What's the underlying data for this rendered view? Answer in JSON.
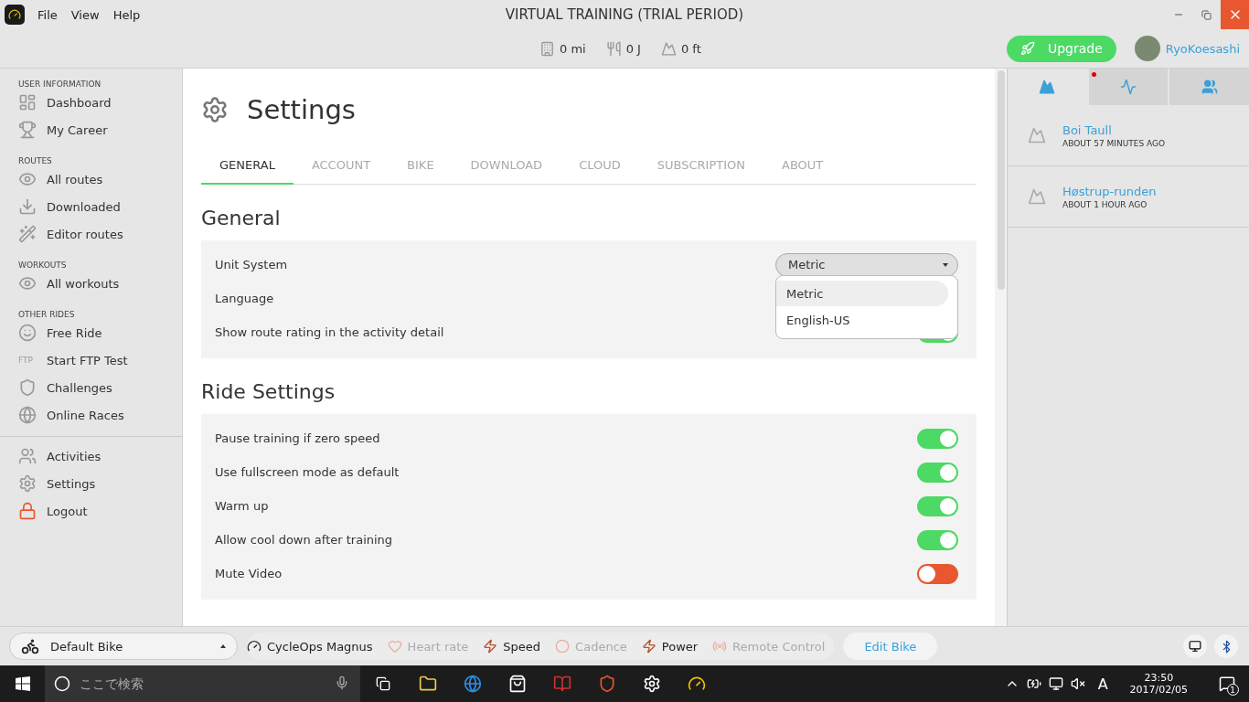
{
  "window": {
    "title": "VIRTUAL TRAINING (TRIAL PERIOD)",
    "menu": [
      "File",
      "View",
      "Help"
    ]
  },
  "stats": [
    "0 mi",
    "0 J",
    "0 ft"
  ],
  "upgrade": "Upgrade",
  "user": "RyoKoesashi",
  "sidebar": [
    {
      "heading": "USER INFORMATION",
      "items": [
        "Dashboard",
        "My Career"
      ]
    },
    {
      "heading": "ROUTES",
      "items": [
        "All routes",
        "Downloaded",
        "Editor routes"
      ]
    },
    {
      "heading": "WORKOUTS",
      "items": [
        "All workouts"
      ]
    },
    {
      "heading": "OTHER RIDES",
      "items": [
        "Free Ride",
        "Start FTP Test",
        "Challenges",
        "Online Races"
      ],
      "ftp_label": "FTP"
    },
    {
      "items": [
        "Activities",
        "Settings",
        "Logout"
      ]
    }
  ],
  "page": {
    "title": "Settings",
    "tabs": [
      {
        "label": "GENERAL",
        "selected": true
      },
      {
        "label": "ACCOUNT",
        "selected": false
      },
      {
        "label": "BIKE",
        "selected": false
      },
      {
        "label": "DOWNLOAD",
        "selected": false
      },
      {
        "label": "CLOUD",
        "selected": false
      },
      {
        "label": "SUBSCRIPTION",
        "selected": false
      },
      {
        "label": "ABOUT",
        "selected": false
      }
    ],
    "sections": [
      {
        "title": "General",
        "rows": [
          {
            "kind": "select",
            "label": "Unit System",
            "value": "Metric",
            "expanded": true,
            "options": [
              {
                "label": "Metric",
                "selected": true
              },
              {
                "label": "English-US",
                "selected": false
              }
            ]
          },
          {
            "kind": "select",
            "label": "Language"
          },
          {
            "kind": "toggle",
            "label": "Show route rating in the activity detail",
            "on": true
          }
        ]
      },
      {
        "title": "Ride Settings",
        "rows": [
          {
            "kind": "toggle",
            "label": "Pause training if zero speed",
            "on": true
          },
          {
            "kind": "toggle",
            "label": "Use fullscreen mode as default",
            "on": true
          },
          {
            "kind": "toggle",
            "label": "Warm up",
            "on": true
          },
          {
            "kind": "toggle",
            "label": "Allow cool down after training",
            "on": true
          },
          {
            "kind": "toggle",
            "label": "Mute Video",
            "on": false
          }
        ]
      }
    ]
  },
  "right_panel": {
    "tabs": [
      {
        "selected": true,
        "notification": false
      },
      {
        "selected": false,
        "notification": true
      },
      {
        "selected": false,
        "notification": false
      }
    ],
    "activities": [
      {
        "name": "Boi Taull",
        "time": "ABOUT 57 MINUTES AGO"
      },
      {
        "name": "Høstrup-runden",
        "time": "ABOUT 1 HOUR AGO"
      }
    ]
  },
  "bottom_bar": {
    "bike": "Default Bike",
    "trainer": "CycleOps Magnus",
    "sensors": [
      {
        "label": "Heart rate",
        "connected": false
      },
      {
        "label": "Speed",
        "connected": true
      },
      {
        "label": "Cadence",
        "connected": false
      },
      {
        "label": "Power",
        "connected": true
      },
      {
        "label": "Remote Control",
        "connected": false
      }
    ],
    "edit": "Edit Bike"
  },
  "taskbar": {
    "search_placeholder": "ここで検索",
    "time": "23:50",
    "date": "2017/02/05",
    "ime": "A",
    "notifications": "1"
  }
}
